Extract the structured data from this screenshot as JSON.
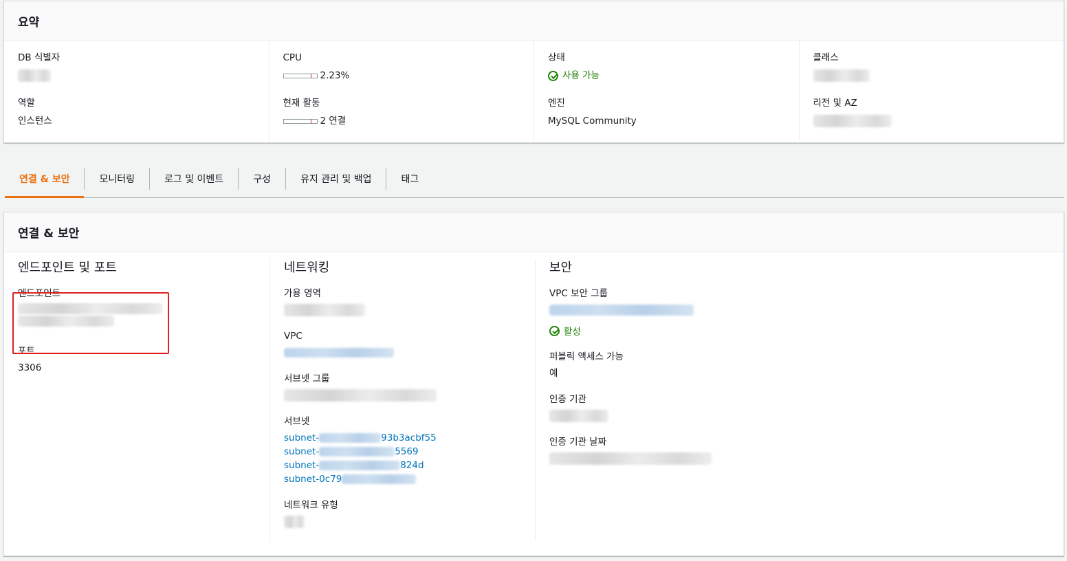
{
  "summary": {
    "title": "요약",
    "db_identifier_label": "DB 식별자",
    "role_label": "역할",
    "role_value": "인스턴스",
    "cpu_label": "CPU",
    "cpu_value": "2.23%",
    "activity_label": "현재 활동",
    "activity_value": "2 연결",
    "status_label": "상태",
    "status_value": "사용 가능",
    "engine_label": "엔진",
    "engine_value": "MySQL Community",
    "class_label": "클래스",
    "region_label": "리전 및 AZ"
  },
  "tabs": [
    {
      "label": "연결 & 보안",
      "active": true
    },
    {
      "label": "모니터링"
    },
    {
      "label": "로그 및 이벤트"
    },
    {
      "label": "구성"
    },
    {
      "label": "유지 관리 및 백업"
    },
    {
      "label": "태그"
    }
  ],
  "connectivity": {
    "title": "연결 & 보안",
    "endpoint_section": {
      "heading": "엔드포인트 및 포트",
      "endpoint_label": "엔드포인트",
      "port_label": "포트",
      "port_value": "3306"
    },
    "networking_section": {
      "heading": "네트워킹",
      "az_label": "가용 영역",
      "vpc_label": "VPC",
      "subnet_group_label": "서브넷 그룹",
      "subnets_label": "서브넷",
      "subnets": [
        "subnet-",
        "subnet-",
        "subnet-",
        "subnet-0c79"
      ],
      "subnet_suffixes": [
        "93b3acbf55",
        "5569",
        "824d",
        ""
      ],
      "network_type_label": "네트워크 유형"
    },
    "security_section": {
      "heading": "보안",
      "vpc_sg_label": "VPC 보안 그룹",
      "vpc_sg_status": "활성",
      "public_access_label": "퍼블릭 액세스 가능",
      "public_access_value": "예",
      "ca_label": "인증 기관",
      "ca_date_label": "인증 기관 날짜"
    }
  },
  "colors": {
    "accent": "#ec7211",
    "success": "#1d8102",
    "link": "#0073bb",
    "highlight_box": "#e02020"
  }
}
